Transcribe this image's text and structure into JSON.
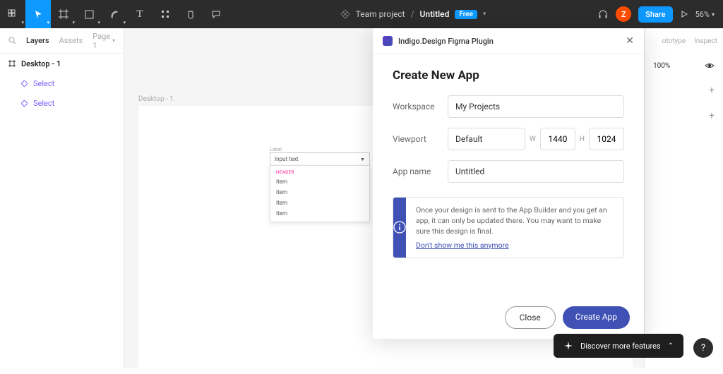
{
  "toolbar": {
    "project_breadcrumb": "Team project",
    "separator": "/",
    "doc_name": "Untitled",
    "plan_badge": "Free",
    "share_label": "Share",
    "zoom": "56%",
    "avatar_initial": "Z"
  },
  "left_panel": {
    "tabs": [
      "Layers",
      "Assets"
    ],
    "page_label": "Page 1",
    "layers": {
      "frame": "Desktop - 1",
      "children": [
        "Select",
        "Select"
      ]
    }
  },
  "right_panel": {
    "tabs": [
      "ototype",
      "Inspect"
    ],
    "opacity": "100%"
  },
  "canvas": {
    "frame_name": "Desktop - 1",
    "combo": {
      "label": "Label",
      "input_text": "Input text",
      "header": "HEADER",
      "items": [
        "Item",
        "Item",
        "Item",
        "Item"
      ]
    }
  },
  "plugin": {
    "name": "Indigo.Design Figma Plugin",
    "title": "Create New App",
    "fields": {
      "workspace_label": "Workspace",
      "workspace_value": "My Projects",
      "viewport_label": "Viewport",
      "viewport_value": "Default",
      "w_label": "W",
      "w_value": "1440",
      "h_label": "H",
      "h_value": "1024",
      "appname_label": "App name",
      "appname_value": "Untitled"
    },
    "info": {
      "text": "Once your design is sent to the App Builder and you get an app, it can only be updated there. You may want to make sure this design is final.",
      "link": "Don't show me this anymore"
    },
    "buttons": {
      "close": "Close",
      "create": "Create App"
    }
  },
  "bottom": {
    "discover": "Discover more features",
    "help": "?"
  }
}
